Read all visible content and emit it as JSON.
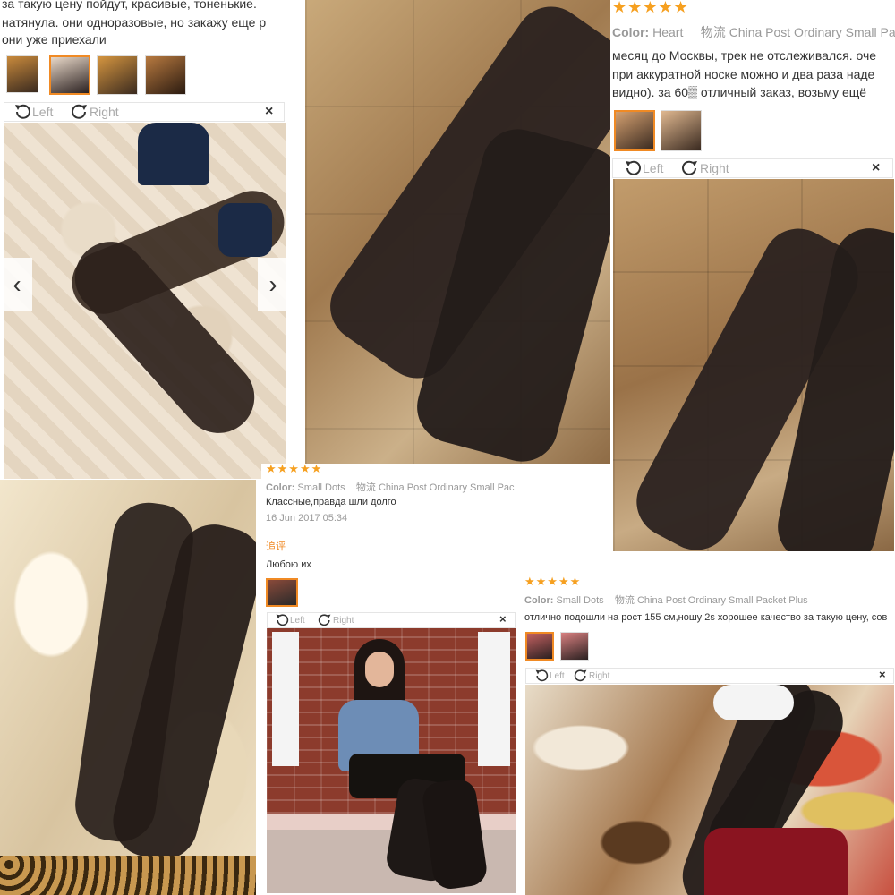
{
  "panel_top_left": {
    "review_lines": [
      "за такую цену пойдут, красивые, тоненькие.",
      "натянула. они одноразовые, но закажу еще р",
      "они уже приехали"
    ],
    "viewer": {
      "left": "Left",
      "right": "Right",
      "close": "×"
    }
  },
  "panel_top_right": {
    "stars": "★★★★★",
    "color_label": "Color:",
    "color_value": "Heart",
    "shipping_label": "物流",
    "shipping_value": "China Post Ordinary Small Pa",
    "review_lines": [
      "месяц до Москвы, трек не отслеживался. оче",
      "при аккуратной носке можно и два раза наде",
      "видно). за 60▒ отличный заказ, возьму ещё"
    ],
    "viewer": {
      "left": "Left",
      "right": "Right",
      "close": "×"
    }
  },
  "panel_middle": {
    "stars": "★★★★★",
    "color_label": "Color:",
    "color_value": "Small Dots",
    "shipping_label": "物流",
    "shipping_value": "China Post Ordinary Small Pac",
    "review": "Классные,правда шли долго",
    "date": "16 Jun 2017 05:34",
    "followup_label": "追评",
    "followup_text": "Любою их",
    "viewer": {
      "left": "Left",
      "right": "Right",
      "close": "×"
    }
  },
  "panel_bottom_right": {
    "stars": "★★★★★",
    "color_label": "Color:",
    "color_value": "Small Dots",
    "shipping_label": "物流",
    "shipping_value": "China Post Ordinary Small Packet Plus",
    "review": "отлично подошли на рост 155 см,ношу 2s хорошее качество за такую цену, сов",
    "viewer": {
      "left": "Left",
      "right": "Right",
      "close": "×"
    }
  },
  "colors": {
    "accent": "#f08a24",
    "stars": "#f6a020",
    "muted": "#999999"
  }
}
